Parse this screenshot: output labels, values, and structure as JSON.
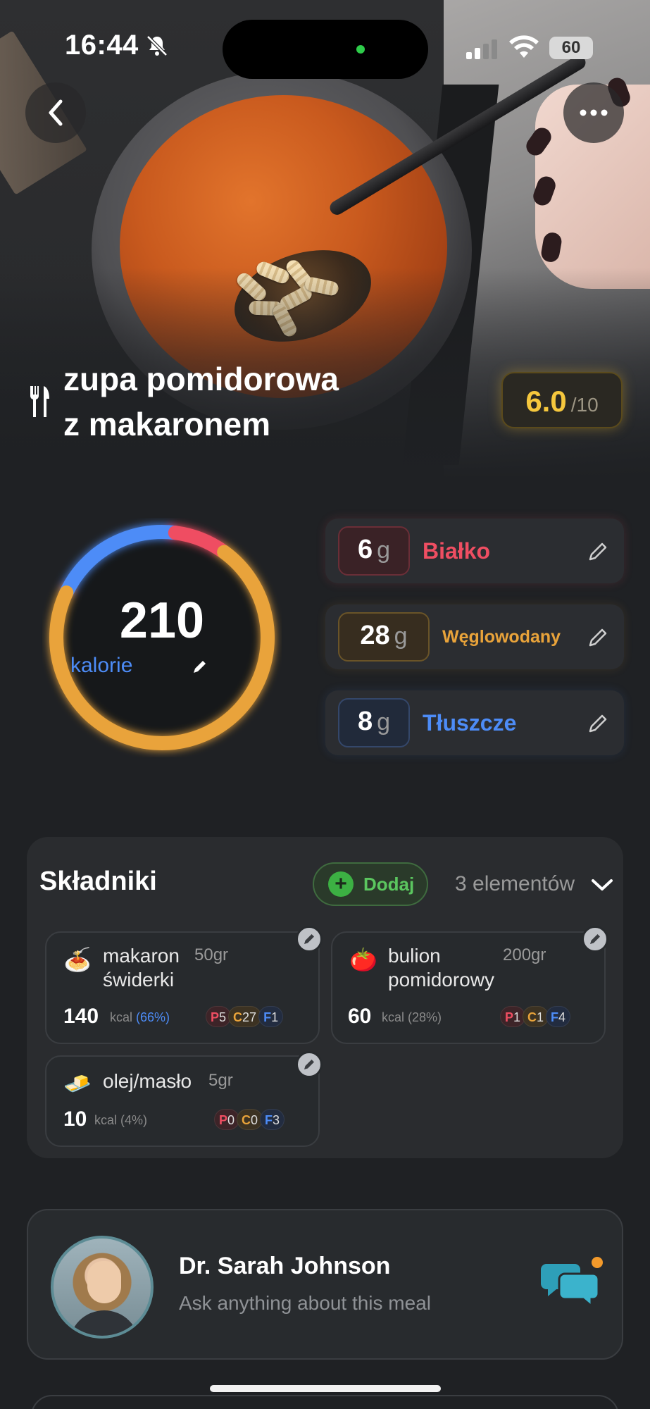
{
  "status_bar": {
    "time": "16:44",
    "battery": "60"
  },
  "meal": {
    "title_line1": "zupa pomidorowa",
    "title_line2": "z makaronem",
    "score": "6.0",
    "score_max": "/10"
  },
  "calories": {
    "value": "210",
    "label": "kalorie"
  },
  "macros": [
    {
      "value": "6",
      "unit": "g",
      "name": "Białko",
      "color": "#ef4e62"
    },
    {
      "value": "28",
      "unit": "g",
      "name": "Węglowodany",
      "color": "#e9a33a"
    },
    {
      "value": "8",
      "unit": "g",
      "name": "Tłuszcze",
      "color": "#4d8cf7"
    }
  ],
  "ingredients": {
    "title": "Składniki",
    "add_label": "Dodaj",
    "count_label": "3 elementów",
    "items": [
      {
        "icon": "spaghetti-icon",
        "emoji": "🍝",
        "name_line1": "makaron",
        "name_line2": "świderki",
        "weight": "50gr",
        "kcal": "140",
        "kcal_unit": "kcal",
        "pct": "(66%)",
        "p": "5",
        "c": "27",
        "f": "1"
      },
      {
        "icon": "tomato-icon",
        "emoji": "🍅",
        "name_line1": "bulion",
        "name_line2": "pomidorowy",
        "weight": "200gr",
        "kcal": "60",
        "kcal_unit": "kcal",
        "pct": "(28%)",
        "p": "1",
        "c": "1",
        "f": "4"
      },
      {
        "icon": "butter-icon",
        "emoji": "🧈",
        "name_line1": "olej/masło",
        "name_line2": "",
        "weight": "5gr",
        "kcal": "10",
        "kcal_unit": "kcal",
        "pct": "(4%)",
        "p": "0",
        "c": "0",
        "f": "3"
      }
    ],
    "chip_letters": {
      "p": "P",
      "c": "C",
      "f": "F"
    }
  },
  "doctor": {
    "name": "Dr. Sarah Johnson",
    "subtitle": "Ask anything about this meal"
  },
  "colors": {
    "protein": "#ef4e62",
    "carbs": "#e9a33a",
    "fat": "#4d8cf7",
    "score": "#f5c73d",
    "add_green": "#5bc65f",
    "chat_teal": "#2e9fb8",
    "chat_badge": "#f39a2b"
  },
  "ring_fractions": {
    "fat": 0.2,
    "protein": 0.08,
    "carbs": 0.72
  }
}
